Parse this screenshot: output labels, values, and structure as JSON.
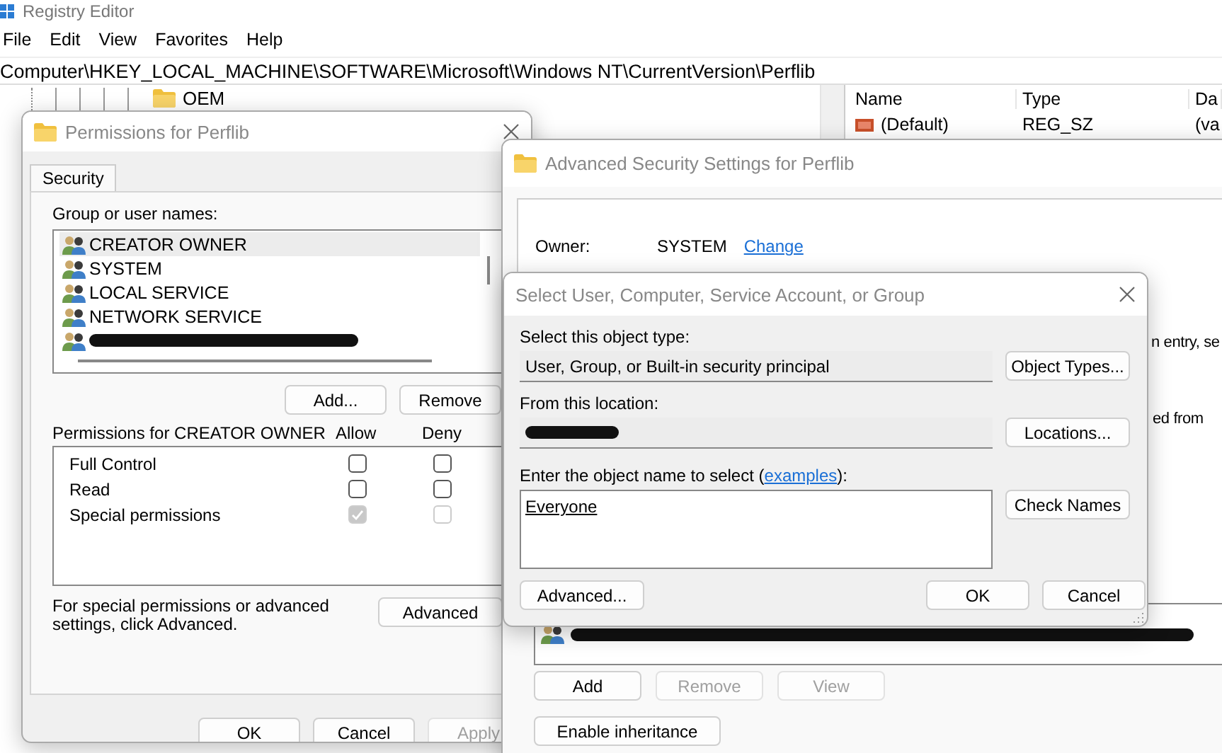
{
  "registry_editor": {
    "title": "Registry Editor",
    "menu": [
      "File",
      "Edit",
      "View",
      "Favorites",
      "Help"
    ],
    "address": "Computer\\HKEY_LOCAL_MACHINE\\SOFTWARE\\Microsoft\\Windows NT\\CurrentVersion\\Perflib",
    "tree": [
      {
        "label": "OEM"
      }
    ],
    "columns": [
      "Name",
      "Type",
      "Da"
    ],
    "rows": [
      {
        "name": "(Default)",
        "type": "REG_SZ",
        "data": "(va"
      }
    ]
  },
  "permissions_dialog": {
    "title": "Permissions for Perflib",
    "tabs": [
      {
        "label": "Security",
        "selected": true
      }
    ],
    "group_label": "Group or user names:",
    "users": [
      {
        "kind": "user",
        "name": "CREATOR OWNER",
        "selected": true
      },
      {
        "kind": "user",
        "name": "SYSTEM",
        "selected": false
      },
      {
        "kind": "user",
        "name": "LOCAL SERVICE",
        "selected": false
      },
      {
        "kind": "user",
        "name": "NETWORK SERVICE",
        "selected": false
      },
      {
        "kind": "redacted",
        "selected": false
      }
    ],
    "list_buttons": [
      "Add...",
      "Remove"
    ],
    "permissions_label": "Permissions for CREATOR OWNER",
    "allow_label": "Allow",
    "deny_label": "Deny",
    "permissions": [
      {
        "name": "Full Control",
        "allow": {
          "checked": false,
          "disabled": false
        },
        "deny": {
          "checked": false,
          "disabled": false
        }
      },
      {
        "name": "Read",
        "allow": {
          "checked": false,
          "disabled": false
        },
        "deny": {
          "checked": false,
          "disabled": false
        }
      },
      {
        "name": "Special permissions",
        "allow": {
          "checked": true,
          "disabled": true
        },
        "deny": {
          "checked": false,
          "disabled": true
        }
      }
    ],
    "note": "For special permissions or advanced settings, click Advanced.",
    "advanced_button": "Advanced",
    "footer_buttons": [
      {
        "label": "OK",
        "disabled": false
      },
      {
        "label": "Cancel",
        "disabled": false
      },
      {
        "label": "Apply",
        "disabled": true
      }
    ]
  },
  "advanced_dialog": {
    "title": "Advanced Security Settings for Perflib",
    "owner_label": "Owner:",
    "owner": "SYSTEM",
    "change_link": "Change",
    "partial_texts": [
      "n entry, se",
      "ed from"
    ],
    "buttons": [
      {
        "label": "Add",
        "disabled": false
      },
      {
        "label": "Remove",
        "disabled": true
      },
      {
        "label": "View",
        "disabled": true
      }
    ],
    "inheritance_button": "Enable inheritance"
  },
  "select_dialog": {
    "title": "Select User, Computer, Service Account, or Group",
    "type_label": "Select this object type:",
    "type_value": "User, Group, or Built-in security principal",
    "type_button": "Object Types...",
    "location_label": "From this location:",
    "location_button": "Locations...",
    "name_label_before": "Enter the object name to select (",
    "name_label_link": "examples",
    "name_label_after": "):",
    "name_value": "Everyone",
    "check_button": "Check Names",
    "advanced_button": "Advanced...",
    "ok_button": "OK",
    "cancel_button": "Cancel"
  }
}
